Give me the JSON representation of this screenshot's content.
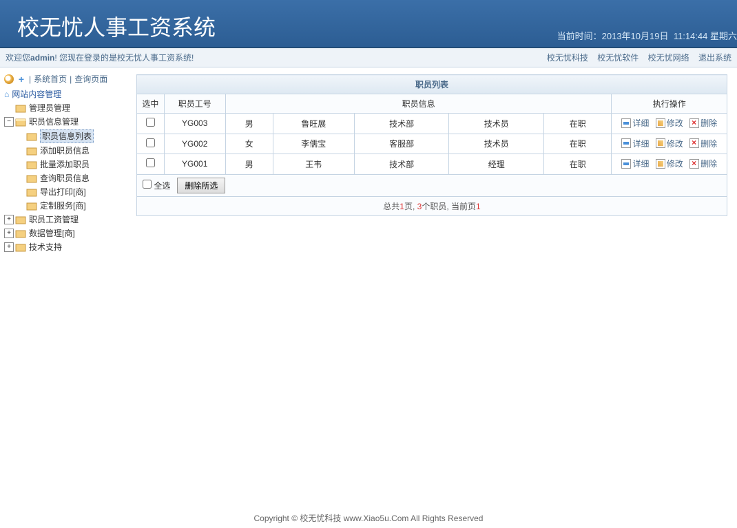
{
  "header": {
    "title": "校无忧人事工资系统",
    "time_label": "当前时间：",
    "date": "2013年10月19日",
    "time": "11:14:44",
    "weekday": "星期六"
  },
  "topbar": {
    "welcome_prefix": "欢迎您",
    "username": "admin",
    "welcome_suffix": "! 您现在登录的是校无忧人事工资系统!",
    "links": [
      "校无忧科技",
      "校无忧软件",
      "校无忧网络",
      "退出系统"
    ]
  },
  "toolbar": {
    "home_link": "系统首页",
    "query_link": "查询页面"
  },
  "tree": {
    "root": "网站内容管理",
    "nodes": [
      {
        "label": "管理员管理",
        "level": 1,
        "hasChildren": false
      },
      {
        "label": "职员信息管理",
        "level": 1,
        "hasChildren": true,
        "expanded": true
      },
      {
        "label": "职员信息列表",
        "level": 2,
        "selected": true
      },
      {
        "label": "添加职员信息",
        "level": 2
      },
      {
        "label": "批量添加职员",
        "level": 2
      },
      {
        "label": "查询职员信息",
        "level": 2
      },
      {
        "label": "导出打印[商]",
        "level": 2
      },
      {
        "label": "定制服务[商]",
        "level": 2
      },
      {
        "label": "职员工资管理",
        "level": 1,
        "hasChildren": true,
        "expanded": false
      },
      {
        "label": "数据管理[商]",
        "level": 1,
        "hasChildren": true,
        "expanded": false
      },
      {
        "label": "技术支持",
        "level": 1,
        "hasChildren": true,
        "expanded": false
      }
    ]
  },
  "table": {
    "title": "职员列表",
    "headers": {
      "select": "选中",
      "emp_id": "职员工号",
      "emp_info": "职员信息",
      "actions": "执行操作"
    },
    "rows": [
      {
        "id": "YG003",
        "gender": "男",
        "name": "鲁旺展",
        "dept": "技术部",
        "position": "技术员",
        "status": "在职"
      },
      {
        "id": "YG002",
        "gender": "女",
        "name": "李儒宝",
        "dept": "客服部",
        "position": "技术员",
        "status": "在职"
      },
      {
        "id": "YG001",
        "gender": "男",
        "name": "王韦",
        "dept": "技术部",
        "position": "经理",
        "status": "在职"
      }
    ],
    "actions": {
      "detail": "详细",
      "edit": "修改",
      "delete": "删除"
    },
    "footer": {
      "select_all": "全选",
      "delete_selected": "删除所选"
    },
    "pager": {
      "prefix": "总共",
      "pages": "1",
      "pages_suffix": "页, ",
      "count": "3",
      "count_suffix": "个职员, 当前页",
      "current": "1"
    }
  },
  "footer": {
    "copyright": "Copyright © 校无忧科技  www.Xiao5u.Com All Rights Reserved"
  }
}
